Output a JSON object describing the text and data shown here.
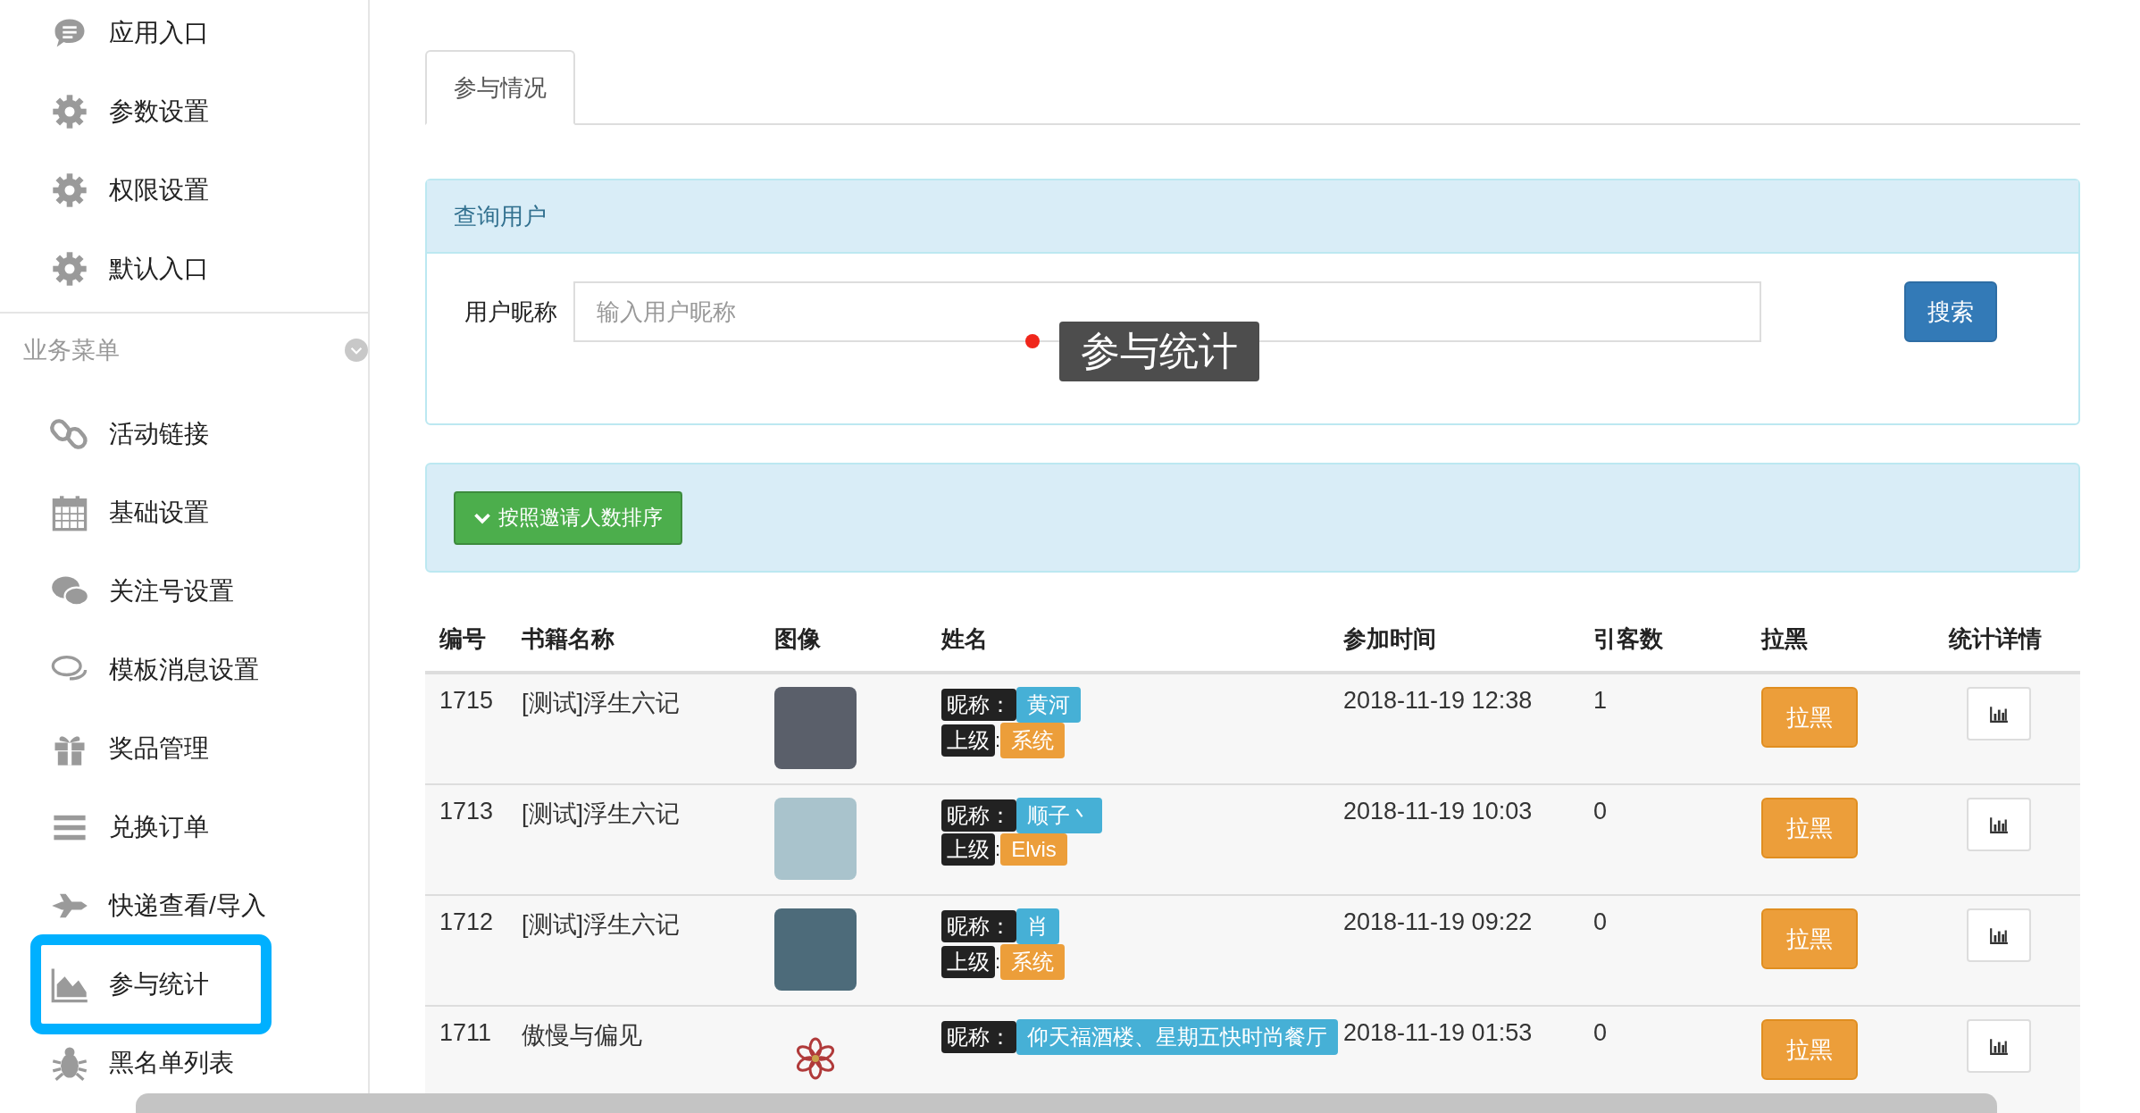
{
  "sidebar": {
    "top_items": [
      {
        "label": "应用入口",
        "selected": false
      },
      {
        "label": "参数设置",
        "selected": false
      },
      {
        "label": "权限设置",
        "selected": false
      },
      {
        "label": "默认入口",
        "selected": false
      }
    ],
    "section_title": "业务菜单",
    "items": [
      {
        "label": "活动链接",
        "selected": false
      },
      {
        "label": "基础设置",
        "selected": false
      },
      {
        "label": "关注号设置",
        "selected": false
      },
      {
        "label": "模板消息设置",
        "selected": false
      },
      {
        "label": "奖品管理",
        "selected": false
      },
      {
        "label": "兑换订单",
        "selected": false
      },
      {
        "label": "快递查看/导入",
        "selected": false
      },
      {
        "label": "参与统计",
        "selected": true
      },
      {
        "label": "黑名单列表",
        "selected": false
      }
    ]
  },
  "tabs": [
    {
      "label": "参与情况",
      "selected": true
    }
  ],
  "search_panel": {
    "title": "查询用户",
    "field_label": "用户昵称",
    "placeholder": "输入用户昵称",
    "button": "搜索"
  },
  "tooltip": "参与统计",
  "sort_button": "按照邀请人数排序",
  "table": {
    "columns": [
      "编号",
      "书籍名称",
      "图像",
      "姓名",
      "参加时间",
      "引客数",
      "拉黑",
      "统计详情"
    ],
    "rows": [
      {
        "id": "1715",
        "book": "[测试]浮生六记",
        "nickname_label": "昵称：",
        "nickname": "黄河",
        "superior_label": "上级",
        "superior_sep": ":",
        "superior": "系统",
        "joined": "2018-11-19 12:38",
        "referrals": "1",
        "block_button": "拉黑"
      },
      {
        "id": "1713",
        "book": "[测试]浮生六记",
        "nickname_label": "昵称：",
        "nickname": "顺子丶",
        "superior_label": "上级",
        "superior_sep": ":",
        "superior": "Elvis",
        "joined": "2018-11-19 10:03",
        "referrals": "0",
        "block_button": "拉黑"
      },
      {
        "id": "1712",
        "book": "[测试]浮生六记",
        "nickname_label": "昵称：",
        "nickname": "肖",
        "superior_label": "上级",
        "superior_sep": ":",
        "superior": "系统",
        "joined": "2018-11-19 09:22",
        "referrals": "0",
        "block_button": "拉黑"
      },
      {
        "id": "1711",
        "book": "傲慢与偏见",
        "nickname_label": "昵称：",
        "nickname": "仰天福酒楼、星期五快时尚餐厅",
        "joined": "2018-11-19 01:53",
        "referrals": "0",
        "block_button": "拉黑"
      }
    ]
  }
}
